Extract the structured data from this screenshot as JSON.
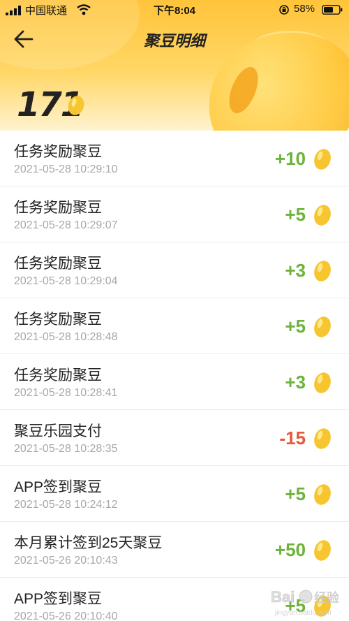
{
  "status_bar": {
    "carrier": "中国联通",
    "time": "下午8:04",
    "battery": "58%"
  },
  "nav": {
    "title": "聚豆明细",
    "back_icon": "arrow-left-icon"
  },
  "balance": {
    "value": "171",
    "icon": "bean-icon"
  },
  "records": [
    {
      "label": "任务奖励聚豆",
      "time": "2021-05-28 10:29:10",
      "amount": "+10",
      "type": "pos"
    },
    {
      "label": "任务奖励聚豆",
      "time": "2021-05-28 10:29:07",
      "amount": "+5",
      "type": "pos"
    },
    {
      "label": "任务奖励聚豆",
      "time": "2021-05-28 10:29:04",
      "amount": "+3",
      "type": "pos"
    },
    {
      "label": "任务奖励聚豆",
      "time": "2021-05-28 10:28:48",
      "amount": "+5",
      "type": "pos"
    },
    {
      "label": "任务奖励聚豆",
      "time": "2021-05-28 10:28:41",
      "amount": "+3",
      "type": "pos"
    },
    {
      "label": "聚豆乐园支付",
      "time": "2021-05-28 10:28:35",
      "amount": "-15",
      "type": "neg"
    },
    {
      "label": "APP签到聚豆",
      "time": "2021-05-28 10:24:12",
      "amount": "+5",
      "type": "pos"
    },
    {
      "label": "本月累计签到25天聚豆",
      "time": "2021-05-26 20:10:43",
      "amount": "+50",
      "type": "pos"
    },
    {
      "label": "APP签到聚豆",
      "time": "2021-05-26 20:10:40",
      "amount": "+5",
      "type": "pos"
    }
  ],
  "colors": {
    "positive": "#6cb23b",
    "negative": "#e6583a",
    "header_gradient_top": "#ffc43a",
    "bean": "#f7c52f"
  },
  "watermark": {
    "text": "Bai du 经验",
    "sub": "jingyan.baidu.com"
  }
}
